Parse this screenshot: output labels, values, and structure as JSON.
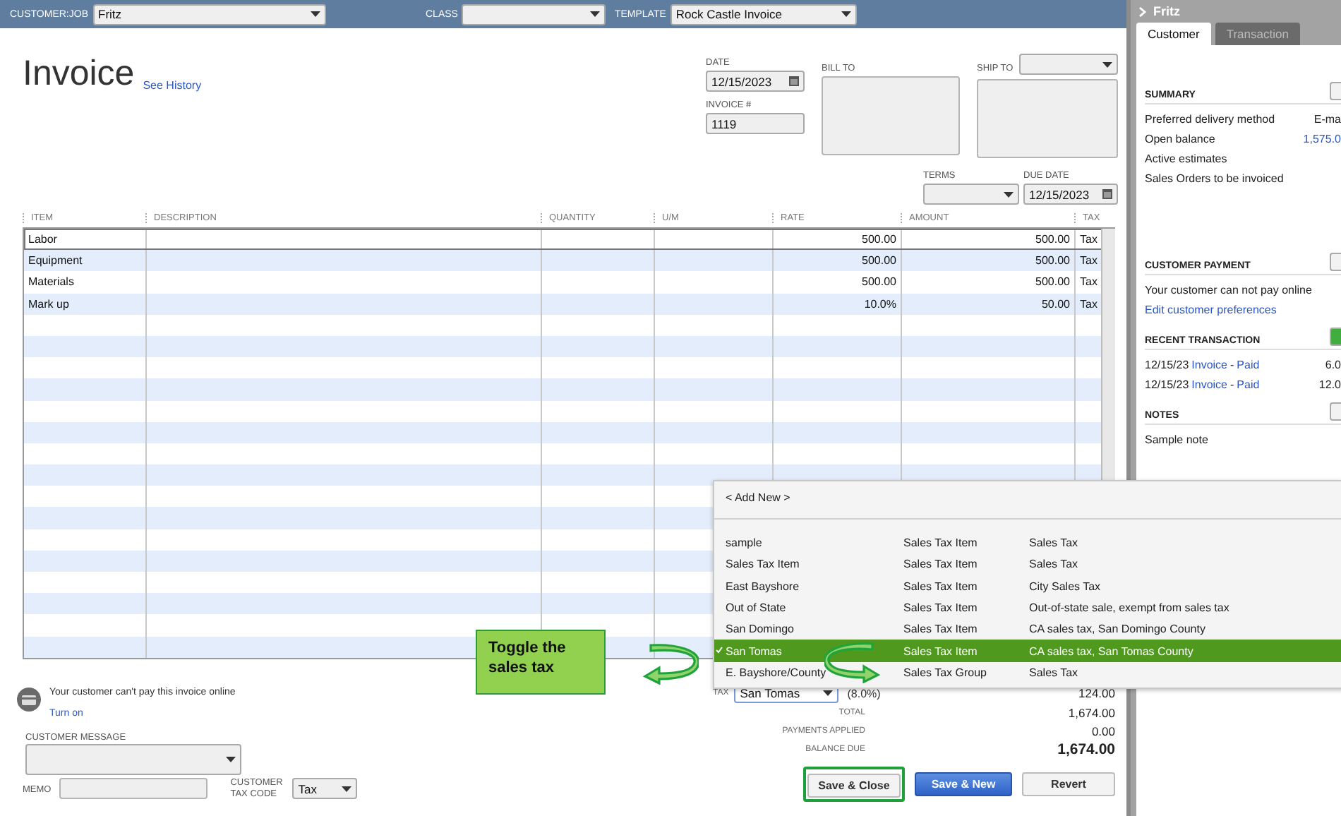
{
  "top_bar": {
    "customer_job": {
      "label": "CUSTOMER:JOB",
      "value": "Fritz"
    },
    "class": {
      "label": "CLASS"
    },
    "template": {
      "label": "TEMPLATE",
      "value": "Rock Castle Invoice"
    }
  },
  "title": "Invoice",
  "see_history": "See History",
  "date": {
    "label": "DATE",
    "value": "12/15/2023"
  },
  "invoice_number": {
    "label": "INVOICE #",
    "value": "1119"
  },
  "bill_to": {
    "label": "BILL TO"
  },
  "ship_to": {
    "label": "SHIP TO"
  },
  "terms": {
    "label": "TERMS"
  },
  "due_date": {
    "label": "DUE DATE",
    "value": "12/15/2023"
  },
  "table": {
    "columns": [
      "ITEM",
      "DESCRIPTION",
      "QUANTITY",
      "U/M",
      "RATE",
      "AMOUNT",
      "TAX"
    ],
    "rows": [
      {
        "item": "Labor",
        "rate": "500.00",
        "amount": "500.00",
        "tax": "Tax",
        "selected": true
      },
      {
        "item": "Equipment",
        "rate": "500.00",
        "amount": "500.00",
        "tax": "Tax",
        "selected": false
      },
      {
        "item": "Materials",
        "rate": "500.00",
        "amount": "500.00",
        "tax": "Tax",
        "selected": false
      },
      {
        "item": "Mark up",
        "rate": "10.0%",
        "amount": "50.00",
        "tax": "Tax",
        "selected": false
      }
    ]
  },
  "payment_notice": {
    "text": "Your customer can't pay this invoice online",
    "link": "Turn on"
  },
  "customer_message": {
    "label": "CUSTOMER MESSAGE"
  },
  "memo": {
    "label": "MEMO"
  },
  "customer_tax_code": {
    "label": "CUSTOMER TAX CODE",
    "value": "Tax"
  },
  "tax": {
    "label": "TAX",
    "value": "San Tomas",
    "rate": "(8.0%)",
    "amount": "124.00"
  },
  "totals": [
    {
      "label": "TOTAL",
      "value": "1,674.00",
      "bold": false
    },
    {
      "label": "PAYMENTS APPLIED",
      "value": "0.00",
      "bold": false
    },
    {
      "label": "BALANCE DUE",
      "value": "1,674.00",
      "bold": true
    }
  ],
  "buttons": [
    {
      "label": "Save & Close",
      "kind": "default",
      "highlighted": true
    },
    {
      "label": "Save & New",
      "kind": "primary",
      "highlighted": false
    },
    {
      "label": "Revert",
      "kind": "default",
      "highlighted": false
    }
  ],
  "tax_dropdown": {
    "add_new": "< Add New >",
    "items": [
      {
        "name": "sample",
        "type": "Sales Tax Item",
        "description": "Sales Tax",
        "selected": false
      },
      {
        "name": "Sales Tax Item",
        "type": "Sales Tax Item",
        "description": "Sales Tax",
        "selected": false
      },
      {
        "name": "East Bayshore",
        "type": "Sales Tax Item",
        "description": "City Sales Tax",
        "selected": false
      },
      {
        "name": "Out of State",
        "type": "Sales Tax Item",
        "description": "Out-of-state sale, exempt from sales tax",
        "selected": false
      },
      {
        "name": "San Domingo",
        "type": "Sales Tax Item",
        "description": "CA sales tax, San Domingo County",
        "selected": false
      },
      {
        "name": "San Tomas",
        "type": "Sales Tax Item",
        "description": "CA sales tax, San Tomas County",
        "selected": true
      },
      {
        "name": "E. Bayshore/County",
        "type": "Sales Tax Group",
        "description": "Sales Tax",
        "selected": false
      }
    ]
  },
  "callout": {
    "text": "Toggle the sales tax"
  },
  "sidebar": {
    "title": "Fritz",
    "tabs": [
      {
        "label": "Customer",
        "selected": true
      },
      {
        "label": "Transaction",
        "selected": false
      }
    ],
    "summary": {
      "title": "SUMMARY",
      "rows": [
        {
          "label": "Preferred delivery method",
          "value": "E-ma",
          "link": false
        },
        {
          "label": "Open balance",
          "value": "1,575.0",
          "link": true
        },
        {
          "label": "Active estimates"
        },
        {
          "label": "Sales Orders to be invoiced"
        }
      ]
    },
    "customer_payment": {
      "title": "CUSTOMER PAYMENT",
      "text": "Your customer can not pay online",
      "link": "Edit customer preferences"
    },
    "recent_transaction": {
      "title": "RECENT TRANSACTION",
      "rows": [
        {
          "date": "12/15/23",
          "type": "Invoice",
          "separator": "-",
          "status": "Paid",
          "amount": "6.0"
        },
        {
          "date": "12/15/23",
          "type": "Invoice",
          "separator": "-",
          "status": "Paid",
          "amount": "12.0"
        }
      ]
    },
    "notes": {
      "title": "NOTES",
      "text": "Sample note"
    }
  }
}
